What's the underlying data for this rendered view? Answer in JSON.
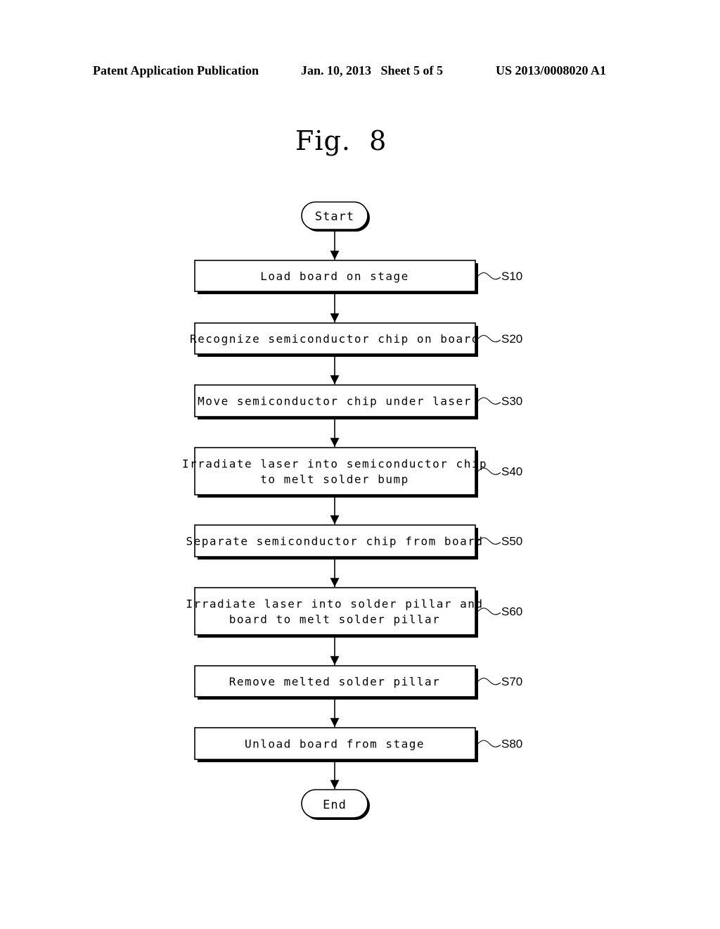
{
  "header": {
    "publication": "Patent Application Publication",
    "date_sheet": "Jan. 10, 2013   Sheet 5 of 5",
    "patent_number": "US 2013/0008020 A1"
  },
  "figure": {
    "title": "Fig.  8"
  },
  "flowchart": {
    "start_label": "Start",
    "end_label": "End",
    "steps": [
      {
        "ref": "S10",
        "lines": [
          "Load board on stage"
        ]
      },
      {
        "ref": "S20",
        "lines": [
          "Recognize semiconductor chip on board"
        ]
      },
      {
        "ref": "S30",
        "lines": [
          "Move semiconductor chip under laser"
        ]
      },
      {
        "ref": "S40",
        "lines": [
          "Irradiate laser into semiconductor chip",
          "to melt solder bump"
        ]
      },
      {
        "ref": "S50",
        "lines": [
          "Separate semiconductor chip from board"
        ]
      },
      {
        "ref": "S60",
        "lines": [
          "Irradiate laser into solder pillar and",
          "board to melt solder pillar"
        ]
      },
      {
        "ref": "S70",
        "lines": [
          "Remove melted solder pillar"
        ]
      },
      {
        "ref": "S80",
        "lines": [
          "Unload board from stage"
        ]
      }
    ]
  }
}
